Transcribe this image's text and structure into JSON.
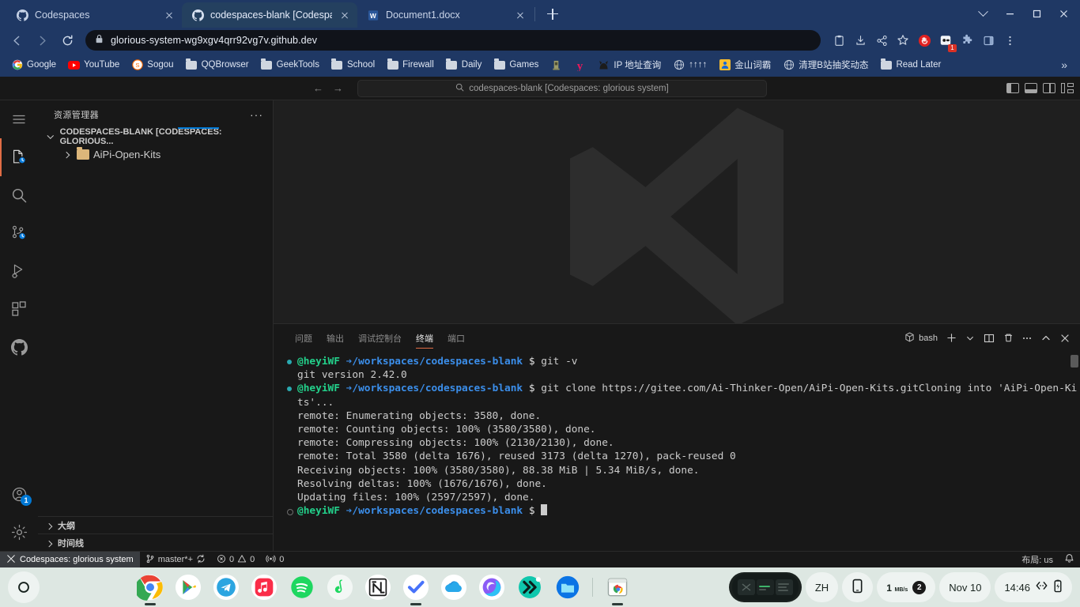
{
  "browser": {
    "tabs": [
      {
        "title": "Codespaces",
        "icon": "github-icon",
        "active": false
      },
      {
        "title": "codespaces-blank [Codespaces",
        "icon": "github-icon",
        "active": true
      },
      {
        "title": "Document1.docx",
        "icon": "word-icon",
        "active": false
      }
    ],
    "new_tab_label": "+",
    "window_controls": {
      "minimize": "—",
      "maximize": "☐",
      "close": "✕"
    },
    "nav": {
      "back": "←",
      "forward": "→",
      "reload": "↻"
    },
    "address": {
      "url": "glorious-system-wg9xgv4qrr92vg7v.github.dev",
      "lock": "lock-icon"
    },
    "toolbar_icons": [
      {
        "name": "clipboard-icon",
        "badge": ""
      },
      {
        "name": "download-icon",
        "badge": ""
      },
      {
        "name": "share-icon",
        "badge": ""
      },
      {
        "name": "bookmark-star-icon",
        "badge": ""
      },
      {
        "name": "adblock-icon",
        "badge": ""
      },
      {
        "name": "extension-dark-icon",
        "badge": "1"
      },
      {
        "name": "puzzle-icon",
        "badge": ""
      },
      {
        "name": "side-panel-icon",
        "badge": ""
      },
      {
        "name": "chrome-menu-icon",
        "badge": ""
      }
    ],
    "bookmarks": [
      {
        "label": "Google",
        "icon": "google-icon"
      },
      {
        "label": "YouTube",
        "icon": "youtube-icon"
      },
      {
        "label": "Sogou",
        "icon": "sogou-icon"
      },
      {
        "label": "QQBrowser",
        "icon": "folder-icon"
      },
      {
        "label": "GeekTools",
        "icon": "folder-icon"
      },
      {
        "label": "School",
        "icon": "folder-icon"
      },
      {
        "label": "Firewall",
        "icon": "folder-icon"
      },
      {
        "label": "Daily",
        "icon": "folder-icon"
      },
      {
        "label": "Games",
        "icon": "folder-icon"
      },
      {
        "label": "",
        "icon": "monument-icon"
      },
      {
        "label": "",
        "icon": "y-icon"
      },
      {
        "label": "IP 地址查询",
        "icon": "cat-icon"
      },
      {
        "label": "↑↑↑↑",
        "icon": "globe-icon"
      },
      {
        "label": "金山词霸",
        "icon": "kingsoft-icon"
      },
      {
        "label": "清理B站抽奖动态",
        "icon": "globe-icon"
      },
      {
        "label": "Read Later",
        "icon": "folder-icon"
      }
    ],
    "bookmarks_overflow": "»"
  },
  "vscode": {
    "titlebar": {
      "back": "←",
      "forward": "→",
      "search_placeholder": "codespaces-blank [Codespaces: glorious system]",
      "search_icon": "search-icon",
      "layout_buttons": [
        "toggle-primary-sidebar",
        "toggle-panel",
        "toggle-secondary-sidebar",
        "customize-layout"
      ]
    },
    "activitybar": [
      {
        "name": "menu-icon",
        "label": "菜单"
      },
      {
        "name": "explorer-icon",
        "label": "资源管理器",
        "active": true
      },
      {
        "name": "search-icon",
        "label": "搜索"
      },
      {
        "name": "source-control-icon",
        "label": "源代码管理"
      },
      {
        "name": "run-debug-icon",
        "label": "运行和调试"
      },
      {
        "name": "extensions-icon",
        "label": "扩展"
      },
      {
        "name": "github-icon",
        "label": "GitHub"
      },
      {
        "name": "accounts-icon",
        "label": "账户",
        "badge": "1"
      },
      {
        "name": "settings-gear-icon",
        "label": "管理"
      }
    ],
    "sidebar": {
      "title": "资源管理器",
      "more_actions": "···",
      "root_folder": "CODESPACES-BLANK [CODESPACES: GLORIOUS...",
      "tree": [
        {
          "label": "AiPi-Open-Kits",
          "type": "folder"
        }
      ],
      "collapsed_sections": [
        "大纲",
        "时间线"
      ]
    },
    "panel": {
      "tabs": [
        {
          "label": "问题",
          "active": false
        },
        {
          "label": "输出",
          "active": false
        },
        {
          "label": "调试控制台",
          "active": false
        },
        {
          "label": "终端",
          "active": true
        },
        {
          "label": "端口",
          "active": false
        }
      ],
      "shell_label": "bash",
      "actions": [
        "new-terminal-icon",
        "terminal-dropdown-icon",
        "split-terminal-icon",
        "kill-terminal-icon",
        "more-actions-icon",
        "maximize-panel-icon",
        "close-panel-icon"
      ]
    },
    "terminal": {
      "user": "@heyiWF",
      "arrow": "➔",
      "path": "/workspaces/codespaces-blank",
      "dollar": "$",
      "lines": [
        {
          "type": "prompt",
          "command": " git -v"
        },
        {
          "type": "out",
          "text": "git version 2.42.0"
        },
        {
          "type": "prompt",
          "command": " git clone https://gitee.com/Ai-Thinker-Open/AiPi-Open-Kits.gitCloning into 'AiPi-Open-Kits'..."
        },
        {
          "type": "out",
          "text": "remote: Enumerating objects: 3580, done."
        },
        {
          "type": "out",
          "text": "remote: Counting objects: 100% (3580/3580), done."
        },
        {
          "type": "out",
          "text": "remote: Compressing objects: 100% (2130/2130), done."
        },
        {
          "type": "out",
          "text": "remote: Total 3580 (delta 1676), reused 3173 (delta 1270), pack-reused 0"
        },
        {
          "type": "out",
          "text": "Receiving objects: 100% (3580/3580), 88.38 MiB | 5.34 MiB/s, done."
        },
        {
          "type": "out",
          "text": "Resolving deltas: 100% (1676/1676), done."
        },
        {
          "type": "out",
          "text": "Updating files: 100% (2597/2597), done."
        },
        {
          "type": "prompt-empty",
          "command": " "
        }
      ]
    },
    "statusbar": {
      "remote": "Codespaces: glorious system",
      "remote_icon": "remote-indicator-icon",
      "branch": "master*+",
      "sync_icon": "sync-icon",
      "errors": "0",
      "warnings": "0",
      "ports": "0",
      "layout": "布局: us",
      "bell_icon": "bell-icon"
    }
  },
  "taskbar": {
    "start": "start-button",
    "apps": [
      {
        "name": "chrome-icon",
        "running": true
      },
      {
        "name": "play-store-icon",
        "running": false
      },
      {
        "name": "telegram-icon",
        "running": false
      },
      {
        "name": "apple-music-icon",
        "running": false
      },
      {
        "name": "spotify-icon",
        "running": false
      },
      {
        "name": "netease-music-icon",
        "running": false
      },
      {
        "name": "notion-icon",
        "running": false
      },
      {
        "name": "ticktick-icon",
        "running": true
      },
      {
        "name": "onedrive-icon",
        "running": false
      },
      {
        "name": "copilot-icon",
        "running": false
      },
      {
        "name": "double-arrow-icon",
        "running": false
      },
      {
        "name": "files-icon",
        "running": false
      },
      {
        "name": "chrome-window-icon",
        "running": true
      }
    ],
    "tray": {
      "widget": "task-preview",
      "language": "ZH",
      "phone_icon": "phone-link-icon",
      "network_value": "1",
      "network_unit": "MB/s",
      "network_badge": "2",
      "date": "Nov 10",
      "time": "14:46",
      "vpn_icon": "vpn-icon",
      "battery_icon": "battery-charging-icon"
    }
  }
}
